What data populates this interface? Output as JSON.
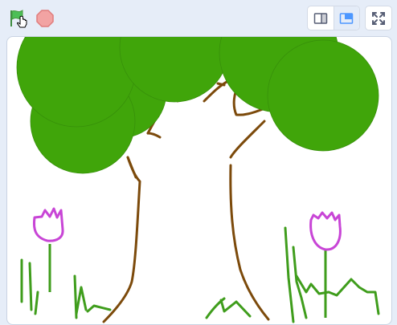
{
  "toolbar": {
    "green_flag": {
      "icon": "green-flag-icon",
      "color": "#4cbf56"
    },
    "stop": {
      "icon": "stop-sign-icon",
      "color": "#ec5959"
    },
    "stage_modes": [
      {
        "icon": "small-stage-icon",
        "active": false
      },
      {
        "icon": "normal-stage-icon",
        "active": true
      }
    ],
    "fullscreen": {
      "icon": "fullscreen-icon"
    }
  },
  "stage": {
    "background": "#ffffff",
    "sprites": [
      {
        "name": "tree-foliage",
        "color": "#40a50a"
      },
      {
        "name": "tree-trunk",
        "color": "#7c4a0b"
      },
      {
        "name": "tulip",
        "color": "#c845d6"
      },
      {
        "name": "grass",
        "color": "#3f9d1c"
      }
    ]
  }
}
